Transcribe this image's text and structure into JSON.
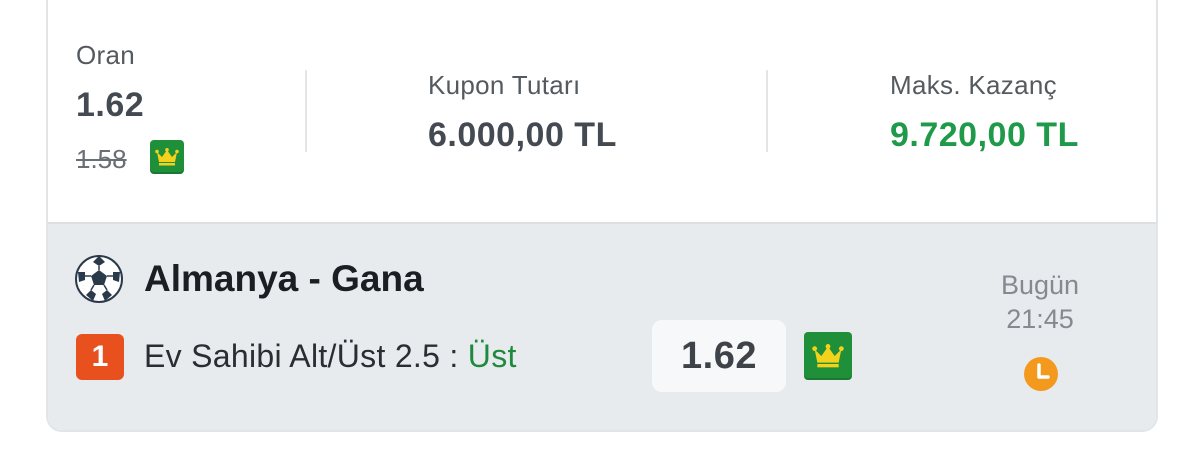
{
  "summary": {
    "odds_label": "Oran",
    "odds_value": "1.62",
    "odds_old": "1.58",
    "coupon_label": "Kupon Tutarı",
    "coupon_value": "6.000,00 TL",
    "max_win_label": "Maks. Kazanç",
    "max_win_value": "9.720,00 TL"
  },
  "match": {
    "title": "Almanya - Gana",
    "pick_number": "1",
    "market": "Ev Sahibi Alt/Üst 2.5 : ",
    "pick": "Üst",
    "odd": "1.62",
    "day": "Bugün",
    "time": "21:45",
    "sport_icon": "soccer-ball-icon",
    "boost_icon": "crown-icon",
    "time_icon": "clock-icon"
  },
  "colors": {
    "win_green": "#1e9a4a",
    "boost_badge": "#1f8f3a",
    "crown_yellow": "#f4d21c",
    "pick_orange": "#e8501e",
    "clock_orange": "#f39a1e",
    "match_bg": "#e8ebee"
  }
}
